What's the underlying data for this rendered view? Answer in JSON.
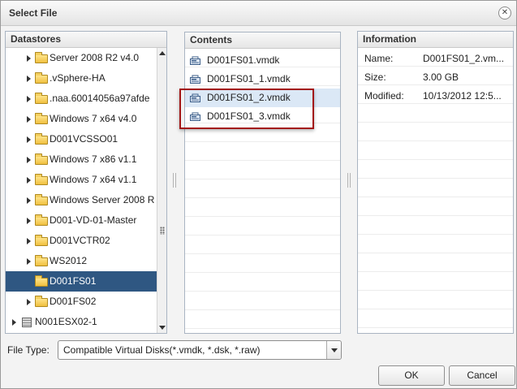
{
  "dialog": {
    "title": "Select File",
    "close_glyph": "✕"
  },
  "datastores": {
    "header": "Datastores",
    "items": [
      {
        "label": "Server 2008 R2 v4.0",
        "type": "folder",
        "expandable": true,
        "selected": false
      },
      {
        "label": ".vSphere-HA",
        "type": "folder",
        "expandable": true,
        "selected": false
      },
      {
        "label": ".naa.60014056a97afde",
        "type": "folder",
        "expandable": true,
        "selected": false
      },
      {
        "label": "Windows 7 x64 v4.0",
        "type": "folder",
        "expandable": true,
        "selected": false
      },
      {
        "label": "D001VCSSO01",
        "type": "folder",
        "expandable": true,
        "selected": false
      },
      {
        "label": "Windows 7 x86 v1.1",
        "type": "folder",
        "expandable": true,
        "selected": false
      },
      {
        "label": "Windows 7 x64 v1.1",
        "type": "folder",
        "expandable": true,
        "selected": false
      },
      {
        "label": "Windows Server 2008 R",
        "type": "folder",
        "expandable": true,
        "selected": false
      },
      {
        "label": "D001-VD-01-Master",
        "type": "folder",
        "expandable": true,
        "selected": false
      },
      {
        "label": "D001VCTR02",
        "type": "folder",
        "expandable": true,
        "selected": false
      },
      {
        "label": "WS2012",
        "type": "folder",
        "expandable": true,
        "selected": false
      },
      {
        "label": "D001FS01",
        "type": "folder",
        "expandable": false,
        "selected": true
      },
      {
        "label": "D001FS02",
        "type": "folder",
        "expandable": true,
        "selected": false
      },
      {
        "label": "N001ESX02-1",
        "type": "host",
        "expandable": true,
        "selected": false
      }
    ]
  },
  "contents": {
    "header": "Contents",
    "items": [
      {
        "label": "D001FS01.vmdk",
        "icon": "virtual-disk-icon",
        "highlighted": false
      },
      {
        "label": "D001FS01_1.vmdk",
        "icon": "virtual-disk-icon",
        "highlighted": false
      },
      {
        "label": "D001FS01_2.vmdk",
        "icon": "virtual-disk-icon",
        "highlighted": true
      },
      {
        "label": "D001FS01_3.vmdk",
        "icon": "virtual-disk-icon",
        "highlighted": false
      }
    ]
  },
  "information": {
    "header": "Information",
    "rows": [
      {
        "key": "Name:",
        "value": "D001FS01_2.vm..."
      },
      {
        "key": "Size:",
        "value": "3.00 GB"
      },
      {
        "key": "Modified:",
        "value": "10/13/2012 12:5..."
      }
    ]
  },
  "file_type": {
    "label": "File Type:",
    "selected": "Compatible Virtual Disks(*.vmdk, *.dsk, *.raw)"
  },
  "buttons": {
    "ok": "OK",
    "cancel": "Cancel"
  },
  "colors": {
    "selection": "#2f5782",
    "row_highlight": "#dbe8f6",
    "annotation": "#a31515"
  }
}
